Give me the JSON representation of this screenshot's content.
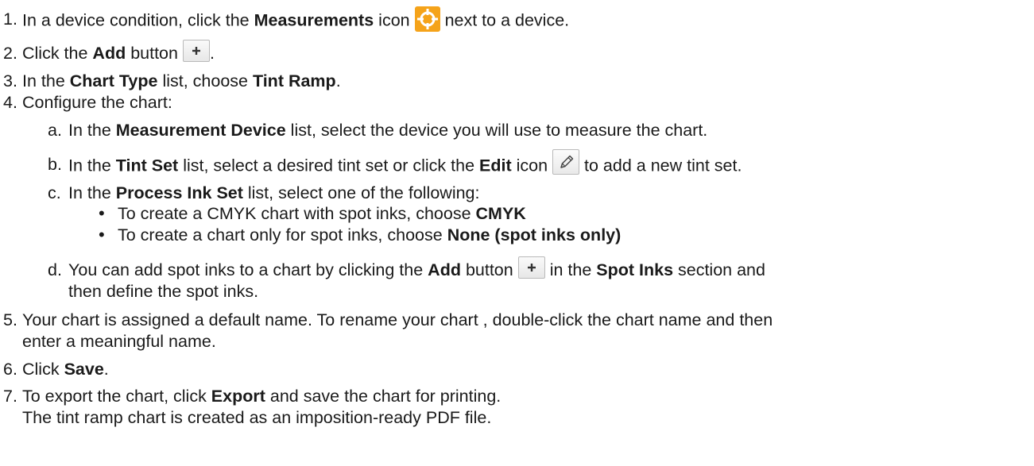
{
  "steps": [
    {
      "num": "1.",
      "pre": "In a device condition, click the ",
      "b1": "Measurements",
      "mid": " icon",
      "post": " next to a device."
    },
    {
      "num": "2.",
      "pre": "Click the ",
      "b1": "Add",
      "mid": " button",
      "post": "."
    },
    {
      "num": "3.",
      "pre": "In the ",
      "b1": "Chart Type",
      "mid": " list, choose ",
      "b2": "Tint Ramp",
      "post": "."
    },
    {
      "num": "4.",
      "text": "Configure the chart:"
    },
    {
      "num": "5.",
      "line1": "Your chart is assigned a default name. To rename your chart , double-click the chart name and then",
      "line2": "enter a meaningful name."
    },
    {
      "num": "6.",
      "pre": "Click ",
      "b1": "Save",
      "post": "."
    },
    {
      "num": "7.",
      "pre": "To export the chart, click ",
      "b1": "Export",
      "post": " and save the chart for printing.",
      "line2": "The tint ramp chart is created as an imposition-ready PDF file."
    }
  ],
  "substeps": [
    {
      "letter": "a.",
      "pre": "In the ",
      "b1": "Measurement Device",
      "post": " list, select the device you will use to measure the chart."
    },
    {
      "letter": "b.",
      "pre": "In the ",
      "b1": "Tint Set",
      "mid": " list, select a desired tint set or click the ",
      "b2": "Edit",
      "mid2": " icon",
      "post": " to add a new tint set."
    },
    {
      "letter": "c.",
      "pre": "In the ",
      "b1": "Process Ink Set",
      "post": " list, select one of the following:"
    },
    {
      "letter": "d.",
      "pre": "You can add spot inks to a chart by clicking the ",
      "b1": "Add",
      "mid": " button",
      "mid2": " in the ",
      "b2": "Spot Inks",
      "post": " section and",
      "line2": "then define the spot inks."
    }
  ],
  "bullets": [
    {
      "symbol": "•",
      "pre": "To create a CMYK chart with spot inks, choose ",
      "b1": "CMYK"
    },
    {
      "symbol": "•",
      "pre": "To create a chart only for spot inks, choose ",
      "b1": "None (spot inks only)"
    }
  ],
  "icons": {
    "measurements": "crosshair-target-icon",
    "add": "plus-icon",
    "edit": "pencil-icon",
    "measurements_color": "#f5a31a"
  }
}
